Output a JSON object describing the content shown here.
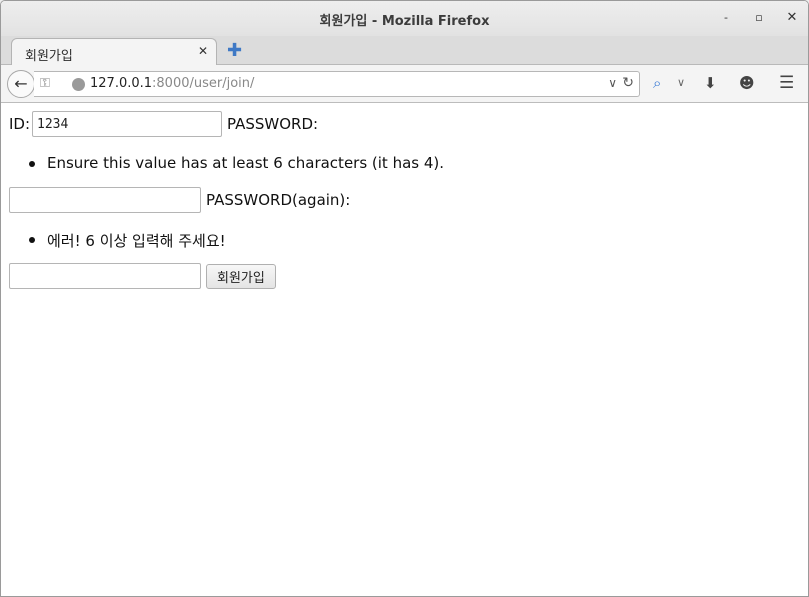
{
  "window": {
    "title": "회원가입 - Mozilla Firefox",
    "minimize_label": "‐",
    "maximize_label": "▫",
    "close_label": "✕"
  },
  "tab": {
    "title": "회원가입",
    "close_label": "✕",
    "new_tab_label": "✚"
  },
  "navbar": {
    "url_host": "127.0.0.1",
    "url_rest": ":8000/user/join/",
    "icons": [
      "back-icon",
      "key-icon",
      "globe-icon",
      "dropdown-icon",
      "reload-icon",
      "search-icon",
      "download-icon",
      "chat-icon",
      "menu-icon"
    ]
  },
  "form": {
    "id_label": "ID:",
    "id_value": "1234",
    "password_label": "PASSWORD:",
    "password_error": "Ensure this value has at least 6 characters (it has 4).",
    "password_value": "",
    "password_again_label": "PASSWORD(again):",
    "password_again_error": "에러! 6 이상 입력해 주세요!",
    "password_again_value": "",
    "submit_label": "회원가입"
  }
}
